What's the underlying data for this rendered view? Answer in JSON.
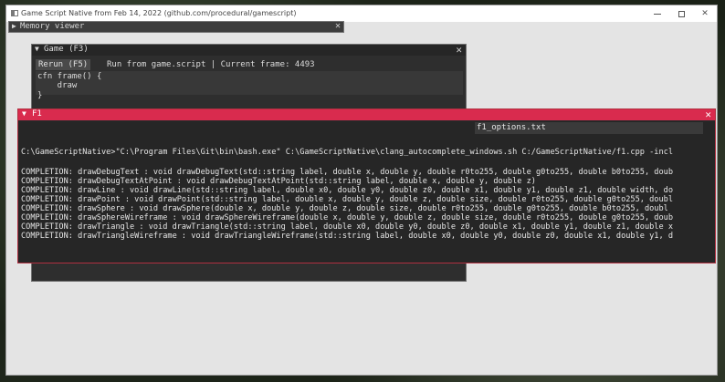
{
  "window": {
    "title": "Game Script Native from Feb 14, 2022 (github.com/procedural/gamescript)"
  },
  "memory_viewer": {
    "arrow": "▶",
    "title": "Memory viewer",
    "close": "✕"
  },
  "game_window": {
    "arrow": "▼",
    "title": "Game (F3)",
    "close": "✕",
    "rerun_label": "Rerun (F5)",
    "frame_info": "Run from game.script | Current frame: 4493",
    "code": [
      "cfn frame() {",
      "    draw",
      "}"
    ]
  },
  "f1_window": {
    "arrow": "▼",
    "title": "F1",
    "close": "✕",
    "tab_label": "f1_options.txt",
    "command": "C:\\GameScriptNative>\"C:\\Program Files\\Git\\bin\\bash.exe\" C:\\GameScriptNative\\clang_autocomplete_windows.sh C:/GameScriptNative/f1.cpp -incl",
    "completions": [
      "COMPLETION: drawDebugText : void drawDebugText(std::string label, double x, double y, double r0to255, double g0to255, double b0to255, doub",
      "COMPLETION: drawDebugTextAtPoint : void drawDebugTextAtPoint(std::string label, double x, double y, double z)",
      "COMPLETION: drawLine : void drawLine(std::string label, double x0, double y0, double z0, double x1, double y1, double z1, double width, do",
      "COMPLETION: drawPoint : void drawPoint(std::string label, double x, double y, double z, double size, double r0to255, double g0to255, doubl",
      "COMPLETION: drawSphere : void drawSphere(double x, double y, double z, double size, double r0to255, double g0to255, double b0to255, doubl",
      "COMPLETION: drawSphereWireframe : void drawSphereWireframe(double x, double y, double z, double size, double r0to255, double g0to255, doub",
      "COMPLETION: drawTriangle : void drawTriangle(std::string label, double x0, double y0, double z0, double x1, double y1, double z1, double x",
      "COMPLETION: drawTriangleWireframe : void drawTriangleWireframe(std::string label, double x0, double y0, double z0, double x1, double y1, d"
    ]
  }
}
